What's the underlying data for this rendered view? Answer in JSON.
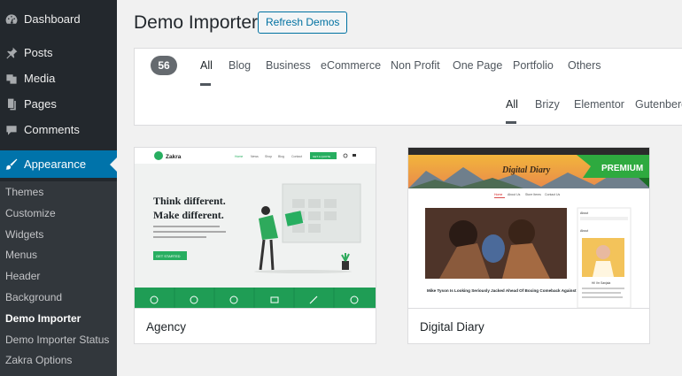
{
  "sidebar": {
    "menu": {
      "dashboard": "Dashboard",
      "posts": "Posts",
      "media": "Media",
      "pages": "Pages",
      "comments": "Comments",
      "appearance": "Appearance"
    },
    "submenu": [
      "Themes",
      "Customize",
      "Widgets",
      "Menus",
      "Header",
      "Background",
      "Demo Importer",
      "Demo Importer Status",
      "Zakra Options"
    ],
    "active_submenu": "Demo Importer"
  },
  "page": {
    "title": "Demo Importer",
    "refresh_label": "Refresh Demos"
  },
  "filters": {
    "count": "56",
    "categories": [
      "All",
      "Blog",
      "Business",
      "eCommerce",
      "Non Profit",
      "One Page",
      "Portfolio",
      "Others"
    ],
    "active_category": "All",
    "builders": [
      "All",
      "Brizy",
      "Elementor",
      "Gutenberg"
    ],
    "active_builder": "All"
  },
  "demos": [
    {
      "title": "Agency",
      "preview": {
        "logo": "Zakra",
        "nav": [
          "Home",
          "News",
          "Shop",
          "Blog",
          "Contact"
        ],
        "nav_button": "GET A QUOTE",
        "headline_1": "Think different.",
        "headline_2": "Make different.",
        "body": "Lorem ipsum dolor sit amet consectetur adipiscing elit sed do eiusmod tempor",
        "cta": "GET STARTED"
      },
      "accent": "#27ae60"
    },
    {
      "title": "Digital Diary",
      "badge": "PREMIUM",
      "preview": {
        "site_title": "Digital Diary",
        "nav": [
          "Home",
          "About Us",
          "Store Items",
          "Contact Us"
        ],
        "post_title": "Mike Tyson Is Looking Seriously Jacked Ahead Of Boxing Comeback Against Roy Jones Jr",
        "widget_title": "About",
        "widget_name": "Hi! I'm Sanjala"
      },
      "accent": "#2eaa3f"
    }
  ]
}
